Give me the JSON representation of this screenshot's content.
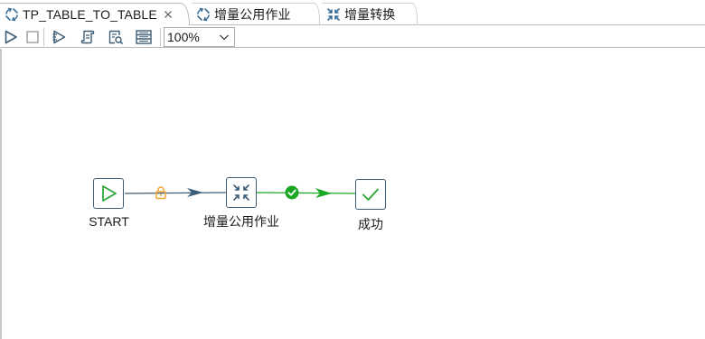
{
  "tabs": [
    {
      "label": "TP_TABLE_TO_TABLE",
      "icon": "job-icon",
      "active": true
    },
    {
      "label": "增量公用作业",
      "icon": "job-icon",
      "active": false
    },
    {
      "label": "增量转换",
      "icon": "transformation-icon",
      "active": false
    }
  ],
  "toolbar": {
    "buttons": [
      "run-icon",
      "stop-icon",
      "run-options-icon",
      "script-icon",
      "sql-preview-icon",
      "database-explorer-icon"
    ],
    "zoom": "100%"
  },
  "canvas": {
    "nodes": [
      {
        "label": "START",
        "icon": "start-play-icon"
      },
      {
        "label": "增量公用作业",
        "icon": "job-icon"
      },
      {
        "label": "成功",
        "icon": "success-check-icon"
      }
    ],
    "hops": [
      {
        "condition": "unconditional",
        "icon": "lock-icon",
        "color": "#f0a830",
        "line_color": "#3d5d77"
      },
      {
        "condition": "on-success",
        "icon": "success-check-icon",
        "color": "#1aa824",
        "line_color": "#1aa824"
      }
    ]
  }
}
